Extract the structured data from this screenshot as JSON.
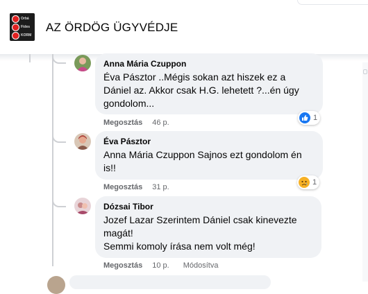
{
  "group": {
    "title": "AZ ÖRDÖG ÜGYVÉDJE",
    "logo_lines": [
      "Orbá",
      "Fides",
      "KORM"
    ]
  },
  "comments": [
    {
      "author": "Anna Mária Czuppon",
      "text": "Éva Pásztor ..Mégis sokan azt hiszek ez a Dániel az. Akkor csak H.G. lehetett ?...én úgy gondolom...",
      "share_label": "Megosztás",
      "time": "46 p.",
      "reaction": {
        "icon": "like-icon",
        "count": "1"
      }
    },
    {
      "author": "Éva Pásztor",
      "text": "Anna Mária Czuppon Sajnos ezt gondolom én is!!",
      "share_label": "Megosztás",
      "time": "31 p.",
      "reaction": {
        "icon": "sad-icon",
        "count": "1"
      }
    },
    {
      "author": "Dózsai Tibor",
      "text_lines": [
        "Jozef Lazar Szerintem Dániel csak kinevezte magát!",
        "Semmi komoly írása nem volt még!"
      ],
      "share_label": "Megosztás",
      "time": "10 p.",
      "edited": "Módosítva"
    }
  ],
  "colors": {
    "bubble": "#f0f2f5",
    "secondary_text": "#65676b",
    "like_blue": "#1877f2",
    "sad_yellow": "#f7b125"
  }
}
